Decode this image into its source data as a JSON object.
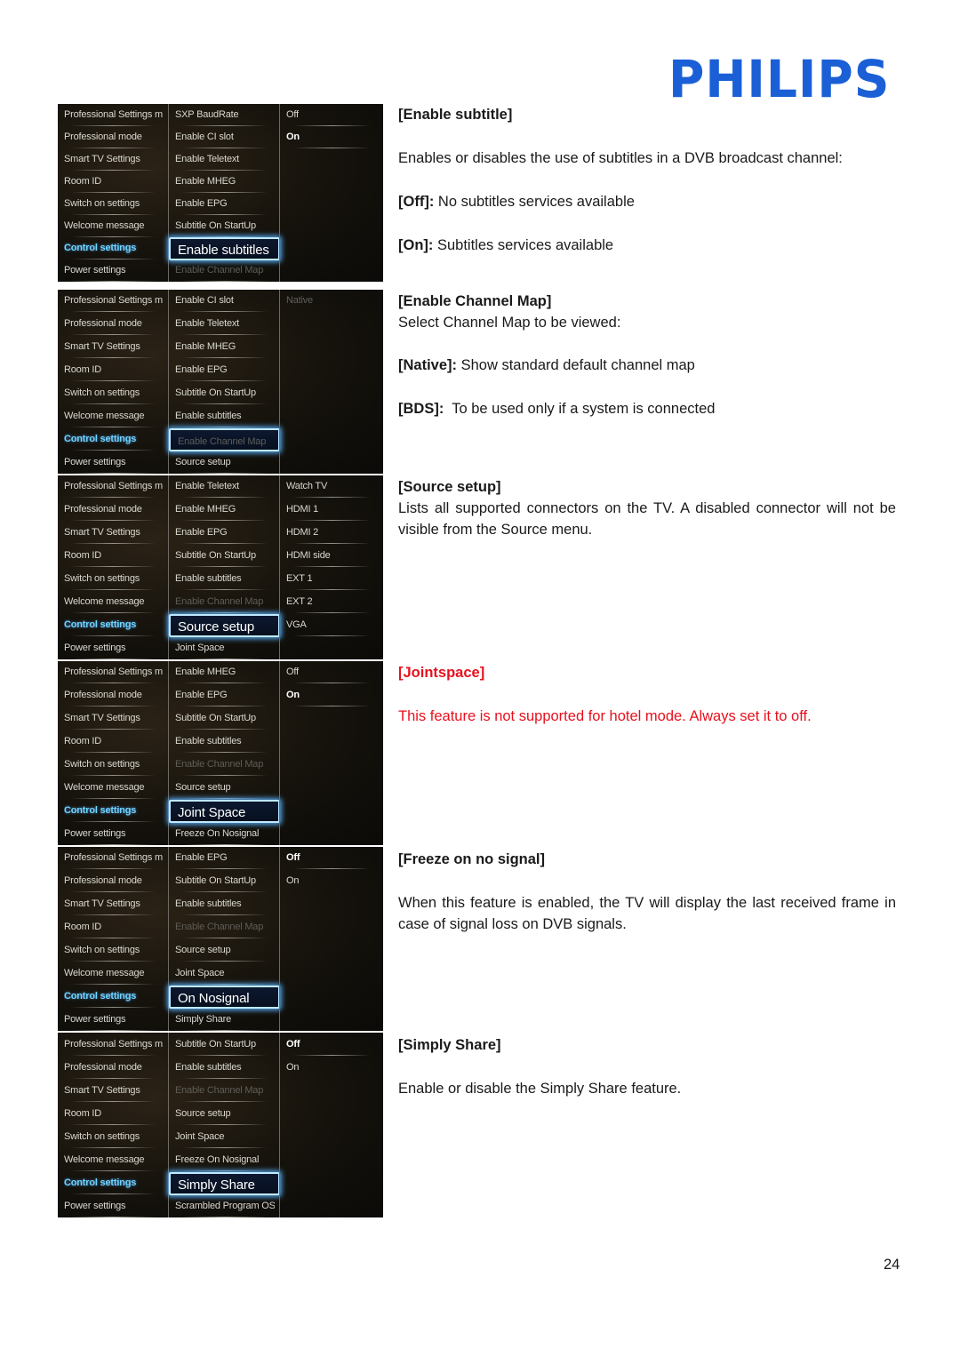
{
  "brand": {
    "logo_text": "PHILIPS",
    "color": "#1a5fd6"
  },
  "tv_menu_main": [
    "Professional Settings m...",
    "Professional mode",
    "Smart TV Settings",
    "Room ID",
    "Switch on settings",
    "Welcome message",
    "Control settings",
    "Power settings"
  ],
  "screens": [
    {
      "col2": [
        "SXP BaudRate",
        "Enable CI slot",
        "Enable Teletext",
        "Enable MHEG",
        "Enable EPG",
        "Subtitle On StartUp",
        "Enable subtitles",
        "Enable Channel Map"
      ],
      "focused_index": 6,
      "col3": [
        "Off",
        "On"
      ],
      "col3_selected": 1
    },
    {
      "col2": [
        "Enable CI slot",
        "Enable Teletext",
        "Enable MHEG",
        "Enable EPG",
        "Subtitle On StartUp",
        "Enable subtitles",
        "Enable Channel Map",
        "Source setup"
      ],
      "focused_index": 6,
      "col3": [
        "Native"
      ],
      "col3_selected": -1
    },
    {
      "col2": [
        "Enable Teletext",
        "Enable MHEG",
        "Enable EPG",
        "Subtitle On StartUp",
        "Enable subtitles",
        "Enable Channel Map",
        "Source setup",
        "Joint Space"
      ],
      "focused_index": 6,
      "col3": [
        "Watch TV",
        "HDMI 1",
        "HDMI 2",
        "HDMI side",
        "EXT 1",
        "EXT 2",
        "VGA"
      ],
      "col3_selected": -1
    },
    {
      "col2": [
        "Enable MHEG",
        "Enable EPG",
        "Subtitle On StartUp",
        "Enable subtitles",
        "Enable Channel Map",
        "Source setup",
        "Joint Space",
        "Freeze On Nosignal"
      ],
      "focused_index": 6,
      "col3": [
        "Off",
        "On"
      ],
      "col3_selected": 1
    },
    {
      "col2": [
        "Enable EPG",
        "Subtitle On StartUp",
        "Enable subtitles",
        "Enable Channel Map",
        "Source setup",
        "Joint Space",
        "On Nosignal",
        "Simply Share"
      ],
      "focused_index": 6,
      "col3": [
        "Off",
        "On"
      ],
      "col3_selected": 0
    },
    {
      "col2": [
        "Subtitle On StartUp",
        "Enable subtitles",
        "Enable Channel Map",
        "Source setup",
        "Joint Space",
        "Freeze On Nosignal",
        "Simply Share",
        "Scrambled Program OSD"
      ],
      "focused_index": 6,
      "col3": [
        "Off",
        "On"
      ],
      "col3_selected": 0
    }
  ],
  "sections": {
    "enable_subtitle": {
      "heading": "[Enable subtitle]",
      "desc": "Enables or disables the use of subtitles in a DVB broadcast channel:",
      "opt1_label": "[Off]:",
      "opt1_text": " No subtitles services available",
      "opt2_label": "[On]:",
      "opt2_text": " Subtitles services available"
    },
    "enable_channel_map": {
      "heading": "[Enable Channel Map]",
      "desc": "Select Channel Map to be viewed:",
      "opt1_label": "[Native]:",
      "opt1_text": " Show standard default channel map",
      "opt2_label": "[BDS]:",
      "opt2_text": "  To be used only if a system is connected"
    },
    "source_setup": {
      "heading": "[Source setup]",
      "desc": "Lists all supported connectors on the TV. A disabled connector will not be visible from the Source menu."
    },
    "jointspace": {
      "heading": "[Jointspace]",
      "desc": "This feature is not supported for hotel mode. Always set it to off.",
      "color": "#e8101e"
    },
    "freeze": {
      "heading": "[Freeze on no signal]",
      "desc": "When this feature is enabled, the TV will display the last received frame in case of signal loss on DVB signals."
    },
    "simply_share": {
      "heading": "[Simply Share]",
      "desc": "Enable or disable the Simply Share feature."
    }
  },
  "page_number": "24"
}
